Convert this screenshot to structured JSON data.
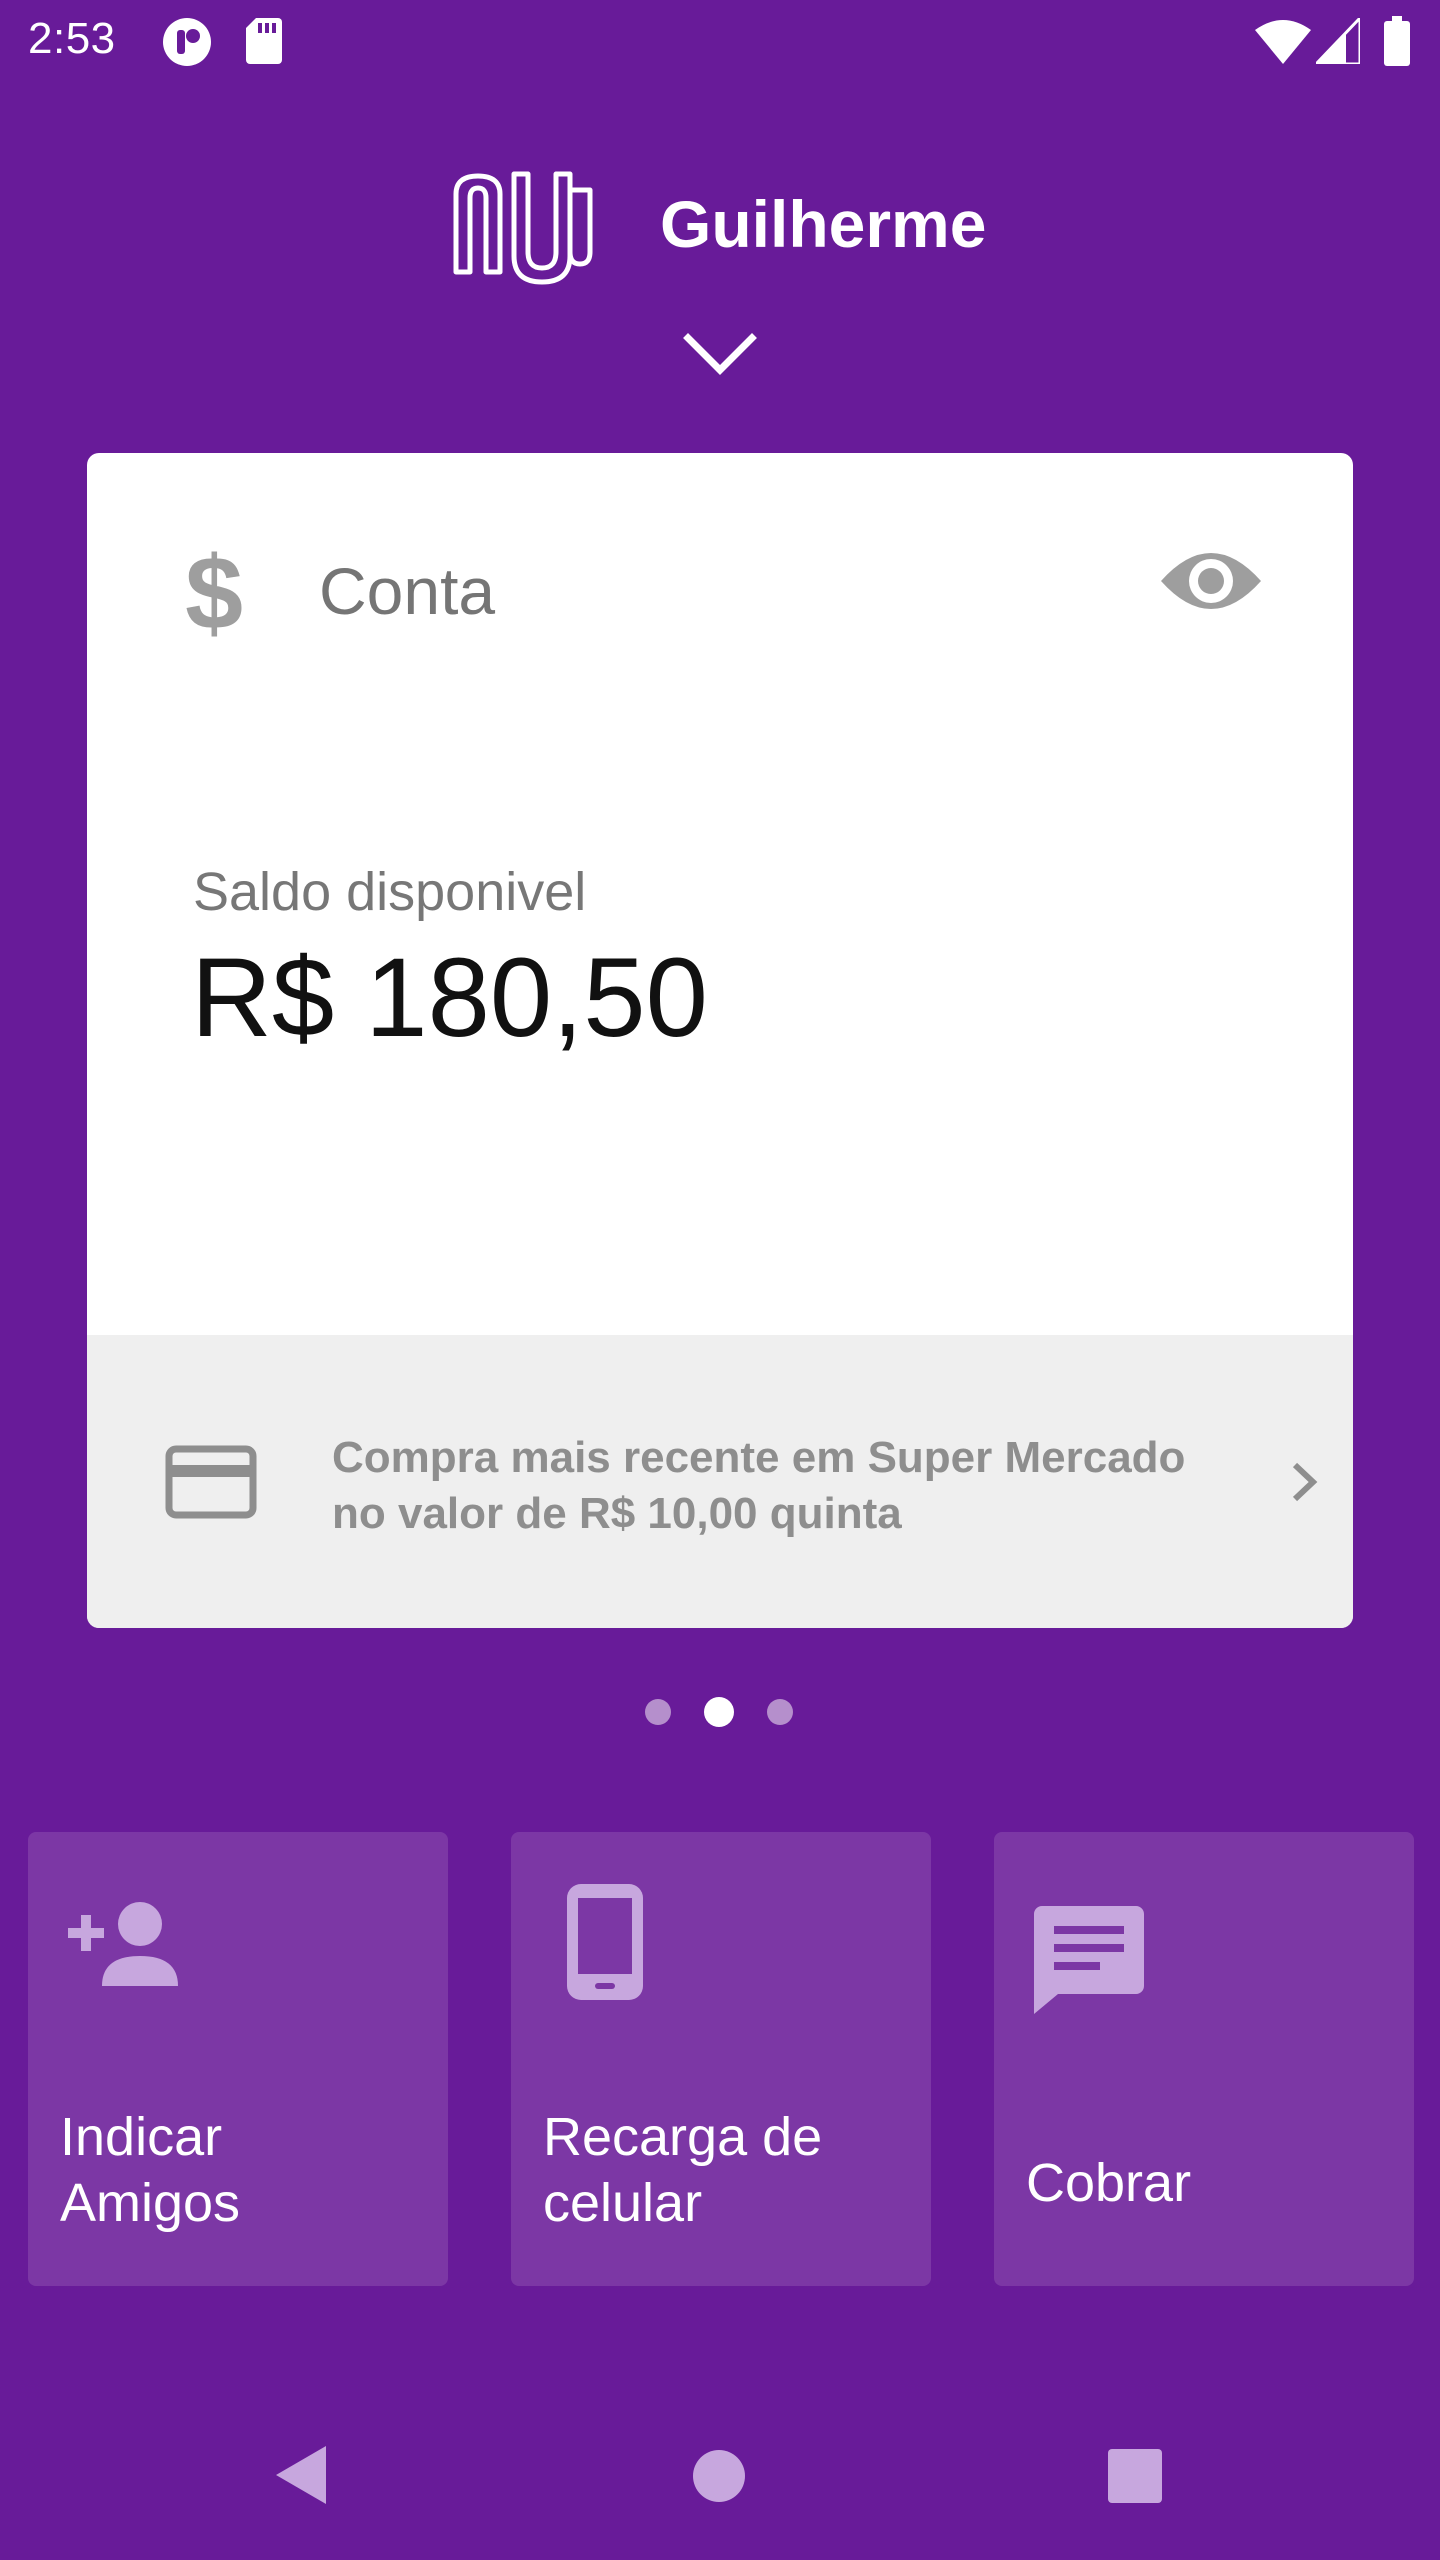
{
  "status_bar": {
    "time": "2:53"
  },
  "header": {
    "user_name": "Guilherme",
    "logo_icon": "nubank-logo",
    "expand_icon": "chevron-down-icon"
  },
  "card": {
    "title": "Conta",
    "title_icon": "dollar-icon",
    "visibility_icon": "eye-icon",
    "balance_label": "Saldo disponivel",
    "balance_value": "R$ 180,50",
    "recent_purchase_line1": "Compra mais recente em Super Mercado",
    "recent_purchase_line2": "no valor de R$ 10,00 quinta",
    "footer_icon": "credit-card-icon",
    "footer_arrow_icon": "chevron-right-icon"
  },
  "pager": {
    "count": 3,
    "active_index": 1
  },
  "shortcuts": [
    {
      "label": "Indicar\nAmigos",
      "icon": "add-person-icon"
    },
    {
      "label": "Recarga de\ncelular",
      "icon": "phone-icon"
    },
    {
      "label": "Cobrar",
      "icon": "message-icon"
    }
  ],
  "nav_bar": {
    "back_icon": "back-icon",
    "home_icon": "home-icon",
    "recents_icon": "recents-icon"
  },
  "colors": {
    "background": "#681b99",
    "tile": "#7c37a5",
    "icon_light": "#c7a7de"
  }
}
